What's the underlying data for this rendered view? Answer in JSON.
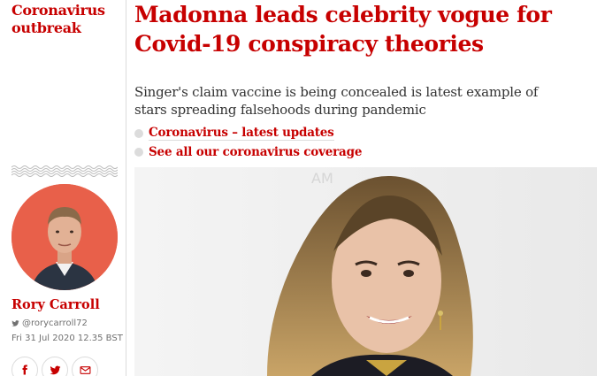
{
  "section": {
    "label": "Coronavirus outbreak"
  },
  "article": {
    "headline": "Madonna leads celebrity vogue for Covid-19 conspiracy theories",
    "standfirst": "Singer's claim vaccine is being concealed is latest example of stars spreading falsehoods during pandemic",
    "links": [
      {
        "label": "Coronavirus – latest updates"
      },
      {
        "label": "See all our coronavirus coverage"
      }
    ]
  },
  "byline": {
    "name": "Rory Carroll",
    "twitter_handle": "@rorycarroll72",
    "date": "Fri 31 Jul 2020 12.35 BST"
  },
  "share": {
    "icons": [
      "facebook-icon",
      "twitter-icon",
      "email-icon"
    ]
  },
  "colors": {
    "accent": "#c70000",
    "avatar_bg": "#e8604a",
    "meta": "#707070",
    "divider": "#dcdcdc"
  }
}
